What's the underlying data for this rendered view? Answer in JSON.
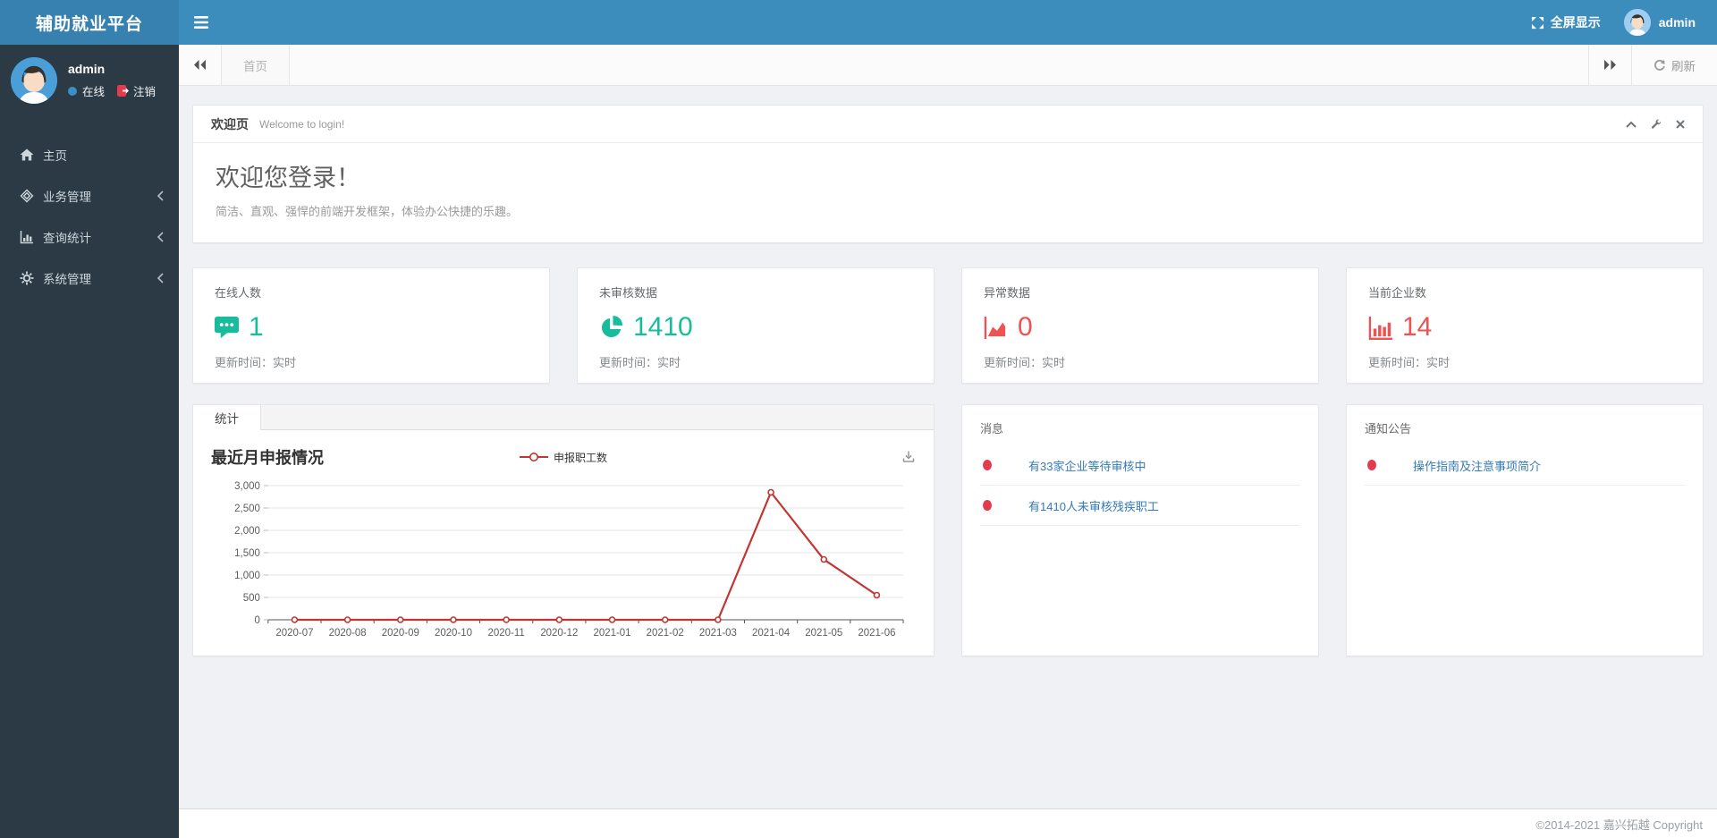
{
  "app": {
    "title": "辅助就业平台"
  },
  "colors": {
    "header_blue": "#3c8dbc",
    "green": "#18bc9c",
    "red": "#ee5253",
    "link_blue": "#337ab7",
    "chart_red": "#c23531",
    "dot_red": "#e23b4e"
  },
  "header": {
    "fullscreen_label": "全屏显示",
    "username": "admin"
  },
  "sidebar": {
    "user": {
      "name": "admin",
      "status": "在线",
      "logout": "注销"
    },
    "items": [
      {
        "label": "主页",
        "icon": "home-icon",
        "has_children": false
      },
      {
        "label": "业务管理",
        "icon": "gem-icon",
        "has_children": true
      },
      {
        "label": "查询统计",
        "icon": "bar-chart-icon",
        "has_children": true
      },
      {
        "label": "系统管理",
        "icon": "gear-icon",
        "has_children": true
      }
    ]
  },
  "tabbar": {
    "active_tab": "首页",
    "refresh_label": "刷新"
  },
  "welcome": {
    "heading": "欢迎页",
    "subheading": "Welcome to login!",
    "title": "欢迎您登录！",
    "description": "简洁、直观、强悍的前端开发框架，体验办公快捷的乐趣。"
  },
  "stats": [
    {
      "label": "在线人数",
      "value": "1",
      "icon": "comment-icon",
      "color": "#18bc9c",
      "note": "更新时间：实时"
    },
    {
      "label": "未审核数据",
      "value": "1410",
      "icon": "pie-icon",
      "color": "#18bc9c",
      "note": "更新时间：实时"
    },
    {
      "label": "异常数据",
      "value": "0",
      "icon": "area-chart-icon",
      "color": "#ee5253",
      "note": "更新时间：实时"
    },
    {
      "label": "当前企业数",
      "value": "14",
      "icon": "bars-icon",
      "color": "#ee5253",
      "note": "更新时间：实时"
    }
  ],
  "chart_panel": {
    "tab": "统计",
    "title": "最近月申报情况",
    "legend": "申报职工数"
  },
  "chart_data": {
    "type": "line",
    "title": "最近月申报情况",
    "x": [
      "2020-07",
      "2020-08",
      "2020-09",
      "2020-10",
      "2020-11",
      "2020-12",
      "2021-01",
      "2021-02",
      "2021-03",
      "2021-04",
      "2021-05",
      "2021-06"
    ],
    "series": [
      {
        "name": "申报职工数",
        "color": "#c23531",
        "values": [
          0,
          0,
          0,
          0,
          0,
          0,
          0,
          0,
          0,
          2850,
          1350,
          550
        ]
      }
    ],
    "xlabel": "",
    "ylabel": "",
    "ylim": [
      0,
      3000
    ],
    "ytick_interval": 500,
    "grid": true,
    "legend_position": "top-center"
  },
  "messages": {
    "title": "消息",
    "items": [
      {
        "text": "有33家企业等待审核中"
      },
      {
        "text": "有1410人未审核残疾职工"
      }
    ]
  },
  "notices": {
    "title": "通知公告",
    "items": [
      {
        "text": "操作指南及注意事项简介"
      }
    ]
  },
  "footer": {
    "copyright": "©2014-2021 嘉兴拓越 Copyright"
  }
}
